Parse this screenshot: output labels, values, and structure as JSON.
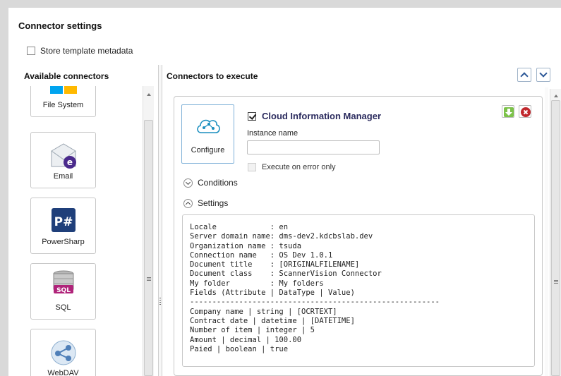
{
  "page": {
    "title": "Connector settings"
  },
  "store_metadata": {
    "label": "Store template metadata",
    "checked": false
  },
  "available": {
    "title": "Available connectors",
    "items": [
      {
        "label": "File System",
        "icon": "file-system-icon"
      },
      {
        "label": "Email",
        "icon": "email-icon"
      },
      {
        "label": "PowerSharp",
        "icon": "powersharp-icon"
      },
      {
        "label": "SQL",
        "icon": "sql-icon"
      },
      {
        "label": "WebDAV",
        "icon": "webdav-icon"
      }
    ]
  },
  "execute": {
    "title": "Connectors to execute",
    "connector": {
      "title": "Cloud Information Manager",
      "enabled": true,
      "configure_label": "Configure",
      "instance_label": "Instance name",
      "instance_value": "",
      "execute_on_error_label": "Execute on error only",
      "execute_on_error_checked": false,
      "conditions_label": "Conditions",
      "settings_label": "Settings",
      "settings_text": "Locale            : en\nServer domain name: dms-dev2.kdcbslab.dev\nOrganization name : tsuda\nConnection name   : OS Dev 1.0.1\nDocument title    : [ORIGINALFILENAME]\nDocument class    : ScannerVision Connector\nMy folder         : My folders\nFields (Attribute | DataType | Value)\n--------------------------------------------------------\nCompany name | string | [OCRTEXT]\nContract date | datetime | [DATETIME]\nNumber of item | integer | 5\nAmount | decimal | 100.00\nPaied | boolean | true"
    }
  },
  "colors": {
    "accent": "#2b5797",
    "move_down": "#5aa02c",
    "remove": "#c0282d"
  }
}
